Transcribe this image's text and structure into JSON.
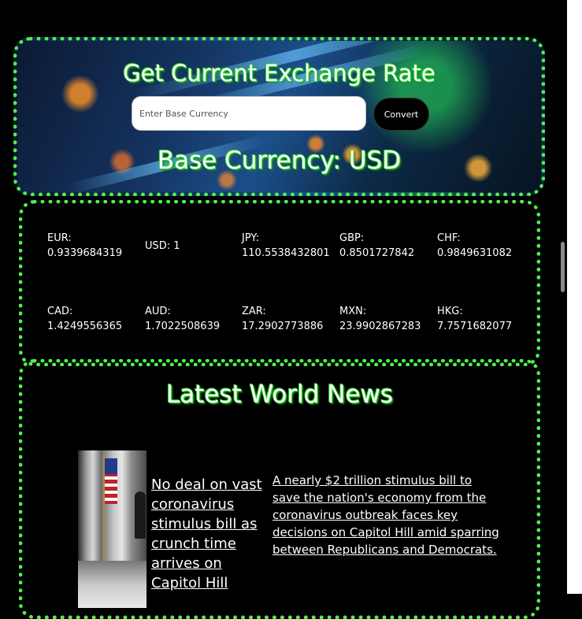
{
  "hero": {
    "title": "Get Current Exchange Rate",
    "input_placeholder": "Enter Base Currency",
    "convert_label": "Convert",
    "base_currency_text": "Base Currency: USD"
  },
  "rates": [
    {
      "code": "EUR:",
      "value": "0.9339684319"
    },
    {
      "code": "USD: 1",
      "value": ""
    },
    {
      "code": "JPY:",
      "value": "110.5538432801"
    },
    {
      "code": "GBP:",
      "value": "0.8501727842"
    },
    {
      "code": "CHF:",
      "value": "0.9849631082"
    },
    {
      "code": "CAD:",
      "value": "1.4249556365"
    },
    {
      "code": "AUD:",
      "value": "1.7022508639"
    },
    {
      "code": "ZAR:",
      "value": "17.2902773886"
    },
    {
      "code": "MXN:",
      "value": "23.9902867283"
    },
    {
      "code": "HKG:",
      "value": "7.7571682077"
    }
  ],
  "news": {
    "heading": "Latest World News",
    "articles": [
      {
        "headline": "No deal on vast coronavirus stimulus bill as crunch time arrives on Capitol Hill",
        "summary": "A nearly $2 trillion stimulus bill to save the nation's economy from the coronavirus outbreak faces key decisions on Capitol Hill amid sparring between Republicans and Democrats."
      }
    ]
  },
  "colors": {
    "accent_green": "#4ef04e",
    "background": "#000000"
  }
}
